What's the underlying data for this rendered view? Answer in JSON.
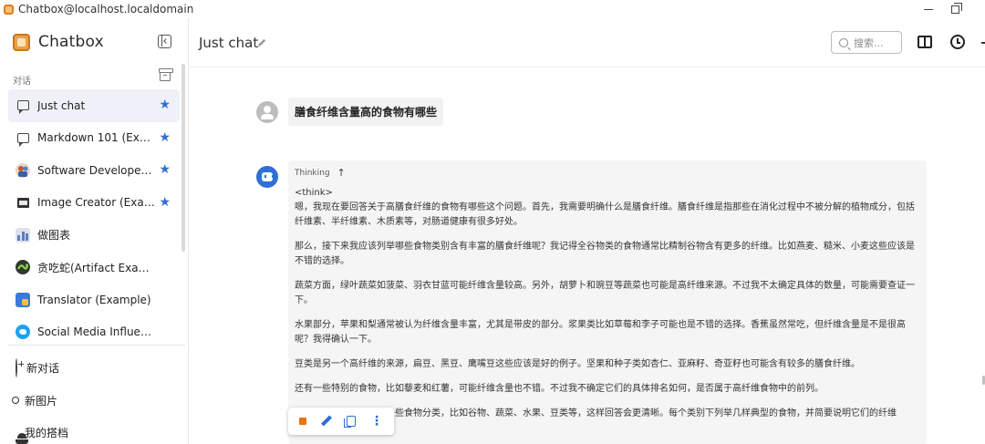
{
  "window": {
    "title": "Chatbox@localhost.localdomain"
  },
  "sidebar": {
    "brand": "Chatbox",
    "section_label": "对话",
    "items": [
      {
        "label": "Just chat",
        "icon": "chat-bubble-icon",
        "starred": true,
        "active": true
      },
      {
        "label": "Markdown 101 (Exa...",
        "icon": "chat-bubble-icon",
        "starred": true,
        "active": false
      },
      {
        "label": "Software Developer (...",
        "icon": "developer-avatar-icon",
        "starred": true,
        "active": false
      },
      {
        "label": "Image Creator (Exam...",
        "icon": "image-icon",
        "starred": true,
        "active": false
      },
      {
        "label": "做图表",
        "icon": "chart-icon",
        "starred": false,
        "active": false
      },
      {
        "label": "贪吃蛇(Artifact Example)",
        "icon": "snake-avatar-icon",
        "starred": false,
        "active": false
      },
      {
        "label": "Translator (Example)",
        "icon": "translator-icon",
        "starred": false,
        "active": false
      },
      {
        "label": "Social Media Influencer (E...",
        "icon": "social-media-icon",
        "starred": false,
        "active": false
      }
    ],
    "actions": [
      {
        "label": "新对话",
        "icon": "plus-circle-icon"
      },
      {
        "label": "新图片",
        "icon": "new-image-icon"
      },
      {
        "label": "我的搭档",
        "icon": "partner-icon"
      }
    ]
  },
  "header": {
    "title": "Just chat",
    "search_placeholder": "搜索..."
  },
  "messages": {
    "user_text": "膳食纤维含量高的食物有哪些",
    "thinking_label": "Thinking",
    "think_tag": "<think>",
    "paragraphs": [
      "嗯，我现在要回答关于高膳食纤维的食物有哪些这个问题。首先，我需要明确什么是膳食纤维。膳食纤维是指那些在消化过程中不被分解的植物成分，包括纤维素、半纤维素、木质素等，对肠道健康有很多好处。",
      "那么，接下来我应该列举哪些食物类别含有丰富的膳食纤维呢？我记得全谷物类的食物通常比精制谷物含有更多的纤维。比如燕麦、糙米、小麦这些应该是不错的选择。",
      "蔬菜方面，绿叶蔬菜如菠菜、羽衣甘蓝可能纤维含量较高。另外，胡萝卜和豌豆等蔬菜也可能是高纤维来源。不过我不太确定具体的数量，可能需要查证一下。",
      "水果部分，苹果和梨通常被认为纤维含量丰富，尤其是带皮的部分。浆果类比如草莓和李子可能也是不错的选择。香蕉虽然常吃，但纤维含量是不是很高呢？我得确认一下。",
      "豆类是另一个高纤维的来源，扁豆、黑豆、鹰嘴豆这些应该是好的例子。坚果和种子类如杏仁、亚麻籽、奇亚籽也可能含有较多的膳食纤维。",
      "还有一些特别的食物，比如藜麦和红薯，可能纤维含量也不错。不过我不确定它们的具体排名如何，是否属于高纤维食物中的前列。",
      "些食物分类，比如谷物、蔬菜、水果、豆类等，这样回答会更清晰。每个类别下列举几样典型的食物，并简要说明它们的纤维"
    ]
  },
  "colors": {
    "accent": "#2f6fd6",
    "active_item_bg": "#eef1f8",
    "stop_button": "#e8730f"
  }
}
